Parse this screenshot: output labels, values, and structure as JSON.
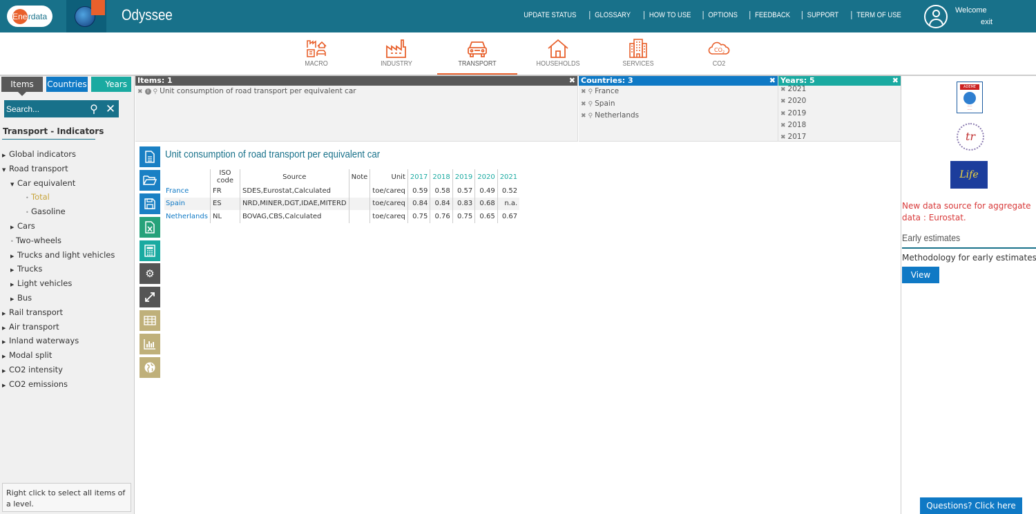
{
  "header": {
    "brand": "Enerdata",
    "brand_e": "Ene",
    "brand_rest": "rdata",
    "app_title": "Odyssee",
    "nav": [
      "UPDATE STATUS",
      "GLOSSARY",
      "HOW TO USE",
      "OPTIONS",
      "FEEDBACK",
      "SUPPORT",
      "TERM OF USE"
    ],
    "welcome": "Welcome",
    "exit": "exit"
  },
  "sectors": [
    {
      "label": "MACRO",
      "icon": "factory-house-icon",
      "active": false
    },
    {
      "label": "INDUSTRY",
      "icon": "industry-icon",
      "active": false
    },
    {
      "label": "TRANSPORT",
      "icon": "car-icon",
      "active": true
    },
    {
      "label": "HOUSEHOLDS",
      "icon": "house-icon",
      "active": false
    },
    {
      "label": "SERVICES",
      "icon": "building-icon",
      "active": false
    },
    {
      "label": "CO2",
      "icon": "co2-cloud-icon",
      "active": false
    }
  ],
  "left": {
    "tabs": {
      "items": "Items",
      "countries": "Countries",
      "years": "Years"
    },
    "search_placeholder": "Search...",
    "tree_title": "Transport - Indicators",
    "tree": [
      {
        "label": "Global indicators",
        "level": 0,
        "type": "caret-right"
      },
      {
        "label": "Road transport",
        "level": 0,
        "type": "caret-down"
      },
      {
        "label": "Car equivalent",
        "level": 1,
        "type": "caret-down"
      },
      {
        "label": "Total",
        "level": 2,
        "type": "dot",
        "selected": true
      },
      {
        "label": "Gasoline",
        "level": 2,
        "type": "dot"
      },
      {
        "label": "Cars",
        "level": 1,
        "type": "caret-right"
      },
      {
        "label": "Two-wheels",
        "level": 1,
        "type": "dot"
      },
      {
        "label": "Trucks and light vehicles",
        "level": 1,
        "type": "caret-right"
      },
      {
        "label": "Trucks",
        "level": 1,
        "type": "caret-right"
      },
      {
        "label": "Light vehicles",
        "level": 1,
        "type": "caret-right"
      },
      {
        "label": "Bus",
        "level": 1,
        "type": "caret-right"
      },
      {
        "label": "Rail transport",
        "level": 0,
        "type": "caret-right"
      },
      {
        "label": "Air transport",
        "level": 0,
        "type": "caret-right"
      },
      {
        "label": "Inland waterways",
        "level": 0,
        "type": "caret-right"
      },
      {
        "label": "Modal split",
        "level": 0,
        "type": "caret-right"
      },
      {
        "label": "CO2 intensity",
        "level": 0,
        "type": "caret-right"
      },
      {
        "label": "CO2 emissions",
        "level": 0,
        "type": "caret-right"
      }
    ],
    "hint": "Right click to select all items of a level."
  },
  "selection": {
    "items_header": "Items: 1",
    "items": [
      "Unit consumption of road transport per equivalent car"
    ],
    "countries_header": "Countries: 3",
    "countries": [
      "France",
      "Spain",
      "Netherlands"
    ],
    "years_header": "Years: 5",
    "years": [
      "2021",
      "2020",
      "2019",
      "2018",
      "2017"
    ]
  },
  "result": {
    "title": "Unit consumption of road transport per equivalent car",
    "columns": [
      "ISO code",
      "Source",
      "Note",
      "Unit",
      "2017",
      "2018",
      "2019",
      "2020",
      "2021"
    ],
    "rows": [
      {
        "country": "France",
        "iso": "FR",
        "source": "SDES,Eurostat,Calculated",
        "note": "",
        "unit": "toe/careq",
        "values": [
          "0.59",
          "0.58",
          "0.57",
          "0.49",
          "0.52"
        ]
      },
      {
        "country": "Spain",
        "iso": "ES",
        "source": "NRD,MINER,DGT,IDAE,MITERD",
        "note": "",
        "unit": "toe/careq",
        "values": [
          "0.84",
          "0.84",
          "0.83",
          "0.68",
          "n.a."
        ]
      },
      {
        "country": "Netherlands",
        "iso": "NL",
        "source": "BOVAG,CBS,Calculated",
        "note": "",
        "unit": "toe/careq",
        "values": [
          "0.75",
          "0.76",
          "0.75",
          "0.65",
          "0.67"
        ]
      }
    ]
  },
  "right": {
    "notice": "New data source for aggregate data : Eurostat.",
    "early_title": "Early estimates",
    "method_label": "Methodology for early estimates",
    "view_label": "View",
    "ademe_label": "ADEME",
    "life_label": "Life",
    "questions_label": "Questions? Click here"
  }
}
